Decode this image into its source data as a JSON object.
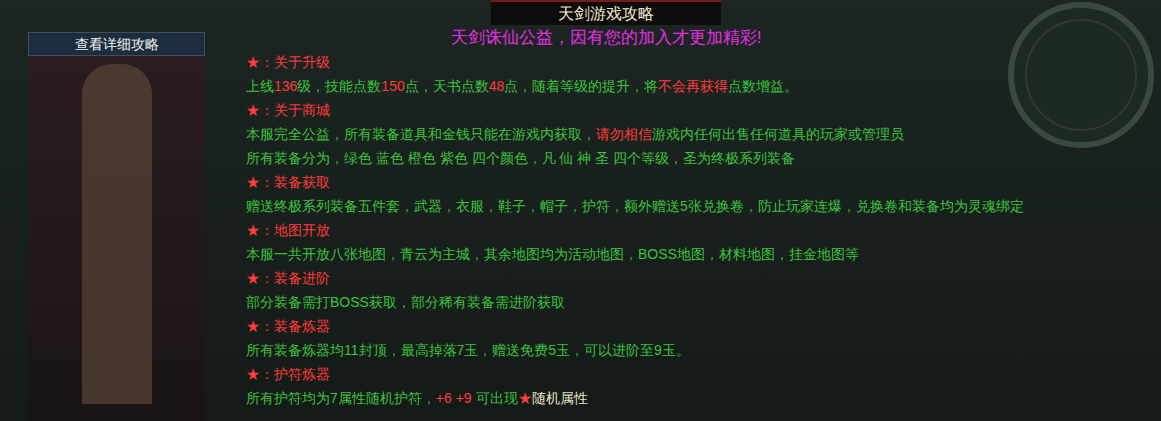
{
  "title": "天剑游戏攻略",
  "subtitle": "天剑诛仙公益，因有您的加入才更加精彩!",
  "side_panel": {
    "button": "查看详细攻略"
  },
  "lines": [
    {
      "kind": "heading",
      "segments": [
        {
          "text": "★：关于升级",
          "color": "#ff3b3b"
        }
      ]
    },
    {
      "kind": "body",
      "segments": [
        {
          "text": "上线",
          "color": "#3cc43c"
        },
        {
          "text": "136",
          "color": "#ff3b3b"
        },
        {
          "text": "级，技能点数",
          "color": "#3cc43c"
        },
        {
          "text": "150",
          "color": "#ff3b3b"
        },
        {
          "text": "点，天书点数",
          "color": "#3cc43c"
        },
        {
          "text": "48",
          "color": "#ff3b3b"
        },
        {
          "text": "点，随着等级的提升，将",
          "color": "#3cc43c"
        },
        {
          "text": "不会再获得",
          "color": "#ff3b3b"
        },
        {
          "text": "点数增益。",
          "color": "#3cc43c"
        }
      ]
    },
    {
      "kind": "heading",
      "segments": [
        {
          "text": "★：关于商城",
          "color": "#ff3b3b"
        }
      ]
    },
    {
      "kind": "body",
      "segments": [
        {
          "text": "本服完全公益，所有装备道具和金钱只能在游戏内获取，",
          "color": "#3cc43c"
        },
        {
          "text": "请勿相信",
          "color": "#ff3b3b"
        },
        {
          "text": "游戏内任何出售任何道具的玩家或管理员",
          "color": "#3cc43c"
        }
      ]
    },
    {
      "kind": "body",
      "segments": [
        {
          "text": "所有装备分为，绿色 蓝色 橙色 紫色 四个颜色，凡 仙 神 圣 四个等级，圣为终极系列装备",
          "color": "#3cc43c"
        }
      ]
    },
    {
      "kind": "heading",
      "segments": [
        {
          "text": "★：装备获取",
          "color": "#ff3b3b"
        }
      ]
    },
    {
      "kind": "body",
      "segments": [
        {
          "text": "赠送终极系列装备五件套，武器，衣服，鞋子，帽子，护符，额外赠送5张兑换卷，防止玩家连爆，兑换卷和装备均为灵魂绑定",
          "color": "#3cc43c"
        }
      ]
    },
    {
      "kind": "heading",
      "segments": [
        {
          "text": "★：地图开放",
          "color": "#ff3b3b"
        }
      ]
    },
    {
      "kind": "body",
      "segments": [
        {
          "text": "本服一共开放八张地图，青云为主城，其余地图均为活动地图，BOSS地图，材料地图，挂金地图等",
          "color": "#3cc43c"
        }
      ]
    },
    {
      "kind": "heading",
      "segments": [
        {
          "text": "★：装备进阶",
          "color": "#ff3b3b"
        }
      ]
    },
    {
      "kind": "body",
      "segments": [
        {
          "text": "部分装备需打BOSS获取，部分稀有装备需进阶获取",
          "color": "#3cc43c"
        }
      ]
    },
    {
      "kind": "heading",
      "segments": [
        {
          "text": "★：装备炼器",
          "color": "#ff3b3b"
        }
      ]
    },
    {
      "kind": "body",
      "segments": [
        {
          "text": "所有装备炼器均11封顶，最高掉落7玉，赠送免费5玉，可以进阶至9玉。",
          "color": "#3cc43c"
        }
      ]
    },
    {
      "kind": "heading",
      "segments": [
        {
          "text": "★：护符炼器",
          "color": "#ff3b3b"
        }
      ]
    },
    {
      "kind": "body",
      "segments": [
        {
          "text": "所有护符均为7属性随机护符，",
          "color": "#3cc43c"
        },
        {
          "text": "+6 +9",
          "color": "#ff3b3b"
        },
        {
          "text": " 可出现",
          "color": "#3cc43c"
        },
        {
          "text": "★",
          "color": "#ff3b3b"
        },
        {
          "text": "随机属性",
          "color": "#e8e6c8"
        }
      ]
    }
  ]
}
